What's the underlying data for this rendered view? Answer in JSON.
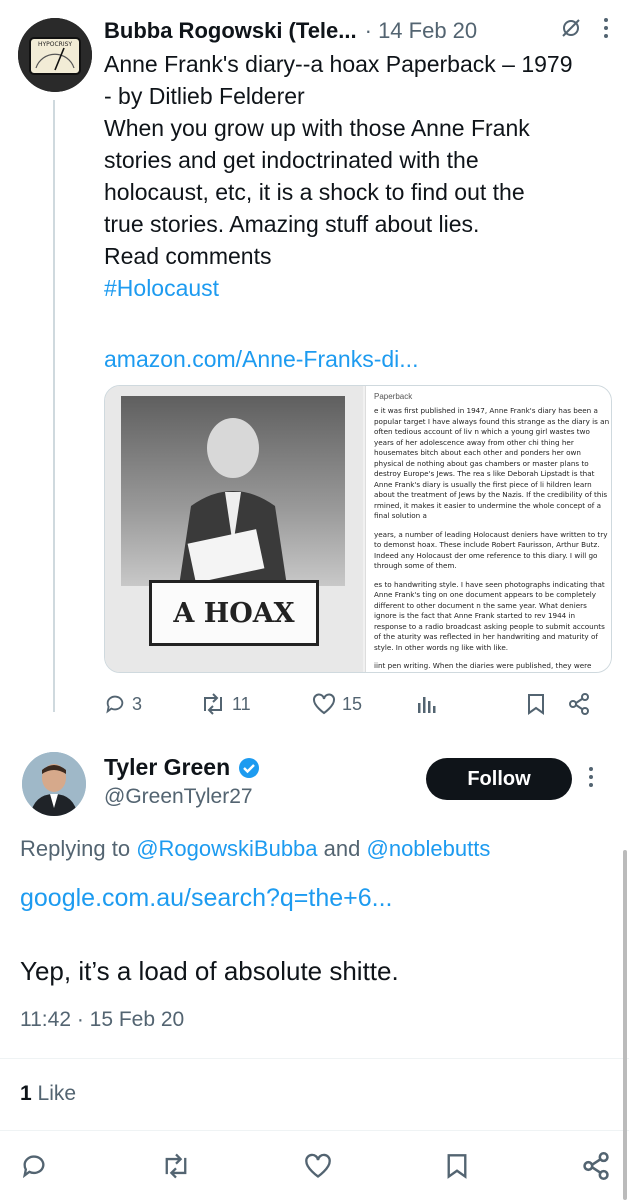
{
  "tweet1": {
    "author_name": "Bubba Rogowski (Tele...",
    "meta": "· 14 Feb 20",
    "lines": [
      "Anne Frank's diary--a hoax Paperback – 1979",
      "- by Ditlieb Felderer",
      "When you grow up with those Anne Frank",
      "stories and get indoctrinated with the",
      "holocaust, etc, it is a shock to find out the",
      "true stories. Amazing stuff about lies.",
      "Read comments"
    ],
    "hashtag": "#Holocaust",
    "link": "amazon.com/Anne-Franks-di...",
    "avatar_label": "HYPOCRISY",
    "media": {
      "cover_text": "A HOAX",
      "page_header": "Paperback",
      "paragraphs": [
        "e it was first published in 1947, Anne Frank's diary has been a popular target I have always found this strange as the diary is an often tedious account of liv n which a young girl wastes two years of her adolescence away from other chi thing her housemates bitch about each other and ponders her own physical de nothing about gas chambers or master plans to destroy Europe's Jews. The rea s like Deborah Lipstadt is that Anne Frank's diary is usually the first piece of li hildren learn about the treatment of Jews by the Nazis. If the credibility of this rmined, it makes it easier to undermine the whole concept of a final solution a",
        "years, a number of leading Holocaust deniers have written to try to demonst hoax. These include Robert Faurisson, Arthur Butz. Indeed any Holocaust der ome reference to this diary. I will go through some of them.",
        "es to handwriting style. I have seen photographs indicating that Anne Frank's ting on one document appears to be completely different to other document n the same year. What deniers ignore is the fact that Anne Frank started to rev 1944 in response to a radio broadcast asking people to submit accounts of the aturity was reflected in her handwriting and maturity of style. In other words ng like with like.",
        "iint pen writing. When the diaries were published, they were compiled often fr rent note books. Anne's father Otto did some censorship of parts of the diary contents were hurtful to other members of their family. There were a small nu tions on some of the pages written by editors in ball point pen, which did n"
      ]
    },
    "replies": "3",
    "retweets": "11",
    "likes": "15"
  },
  "tweet2": {
    "author_name": "Tyler Green",
    "handle": "@GreenTyler27",
    "follow_label": "Follow",
    "replying_prefix": "Replying to",
    "replying_user1": "@RogowskiBubba",
    "replying_and": "and",
    "replying_user2": "@noblebutts",
    "link": "google.com.au/search?q=the+6...",
    "text": "Yep, it’s a load of absolute shitte.",
    "timestamp": "11:42 · 15 Feb 20",
    "like_count": "1",
    "like_label": "Like"
  },
  "colors": {
    "accent": "#1d9bf0",
    "muted": "#536471",
    "text": "#0f1419",
    "verified": "#1d9bf0"
  }
}
